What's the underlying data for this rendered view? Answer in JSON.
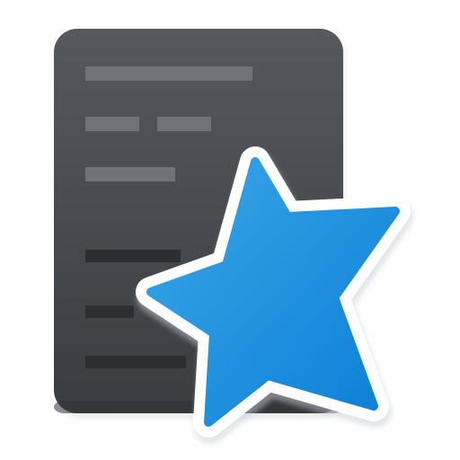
{
  "icon": {
    "name": "app-icon",
    "card_icon": "flashcard-icon",
    "star_icon": "star-icon"
  },
  "colors": {
    "card_top": "#55595d",
    "card_bottom": "#3a3d40",
    "card_edge": "#2f3236",
    "line_light": "#6f7276",
    "line_dark": "#2c2f32",
    "star_light": "#3aa7e8",
    "star_dark": "#0c7fd6",
    "outline": "#ffffff",
    "shadow": "#d9dde1"
  }
}
